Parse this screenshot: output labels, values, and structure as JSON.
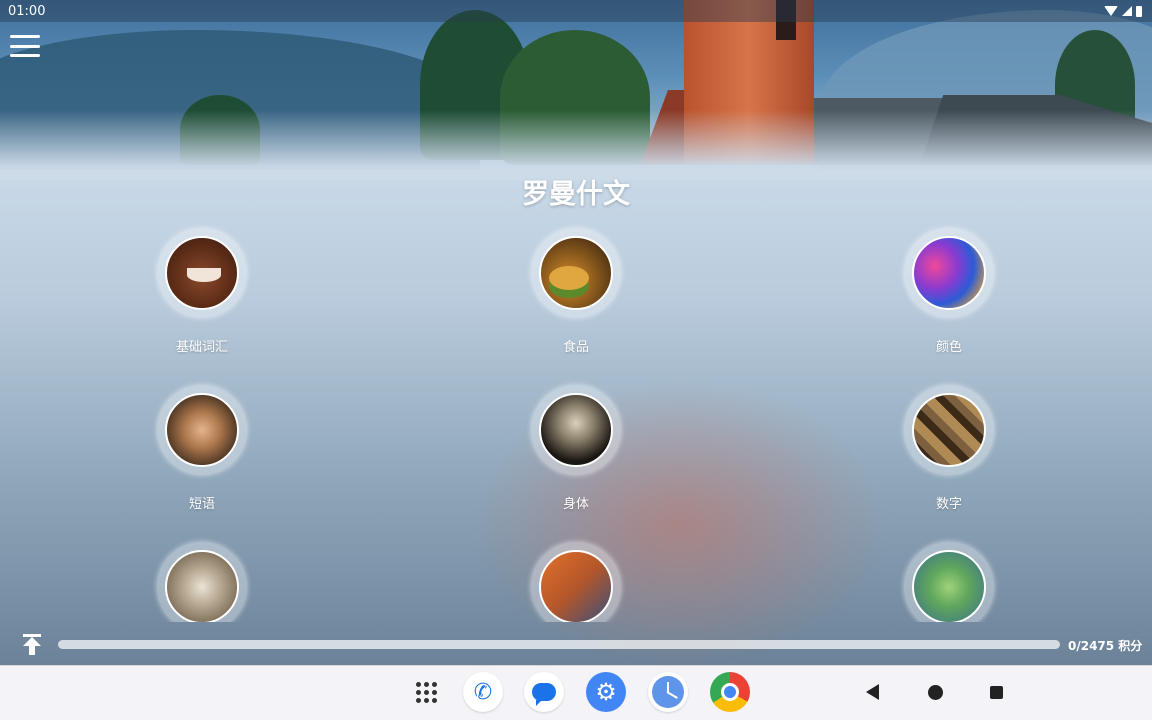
{
  "status_bar": {
    "time": "01:00",
    "icons": [
      "wifi-icon",
      "signal-icon",
      "battery-icon"
    ]
  },
  "header": {
    "menu_icon": "hamburger-menu-icon",
    "title": "罗曼什文"
  },
  "categories": [
    {
      "label": "基础词汇"
    },
    {
      "label": "食品"
    },
    {
      "label": "颜色"
    },
    {
      "label": "短语"
    },
    {
      "label": "身体"
    },
    {
      "label": "数字"
    },
    {
      "label": ""
    },
    {
      "label": ""
    },
    {
      "label": ""
    }
  ],
  "progress": {
    "points_text": "0/2475 积分",
    "fraction": 0
  },
  "dock": {
    "apps": [
      "app-drawer-icon",
      "phone-icon",
      "messages-icon",
      "settings-icon",
      "clock-icon",
      "chrome-icon"
    ]
  },
  "nav": [
    "back-icon",
    "home-icon",
    "recents-icon"
  ],
  "colors": {
    "accent": "#3aa0e0",
    "dock_bg": "#f4f3f8"
  }
}
